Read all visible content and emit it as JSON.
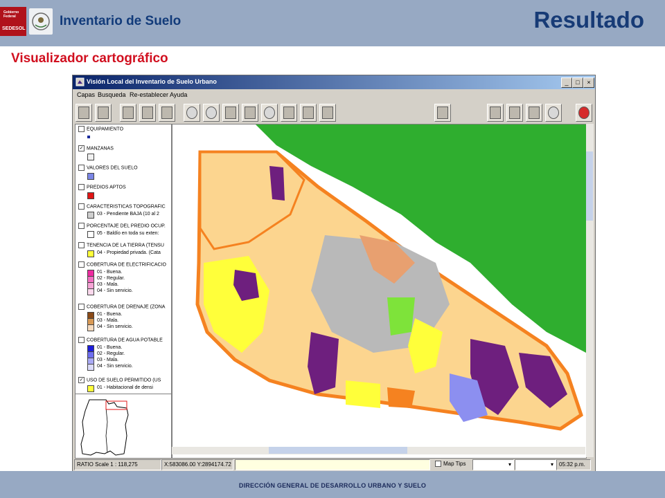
{
  "header": {
    "sedesol_top": "Gobierno Federal",
    "sedesol_name": "SEDESOL",
    "app_title": "Inventario de Suelo",
    "page_heading": "Resultado",
    "subtitle": "Visualizador cartográfico"
  },
  "window": {
    "title": "Visión Local del Inventario de Suelo Urbano",
    "menu": [
      "Capas",
      "Busqueda",
      "Re-establecer",
      "Ayuda"
    ],
    "toolbar_icons": [
      "print-icon",
      "add-layer-icon",
      "list-icon",
      "layer-down-icon",
      "layer-table-icon",
      "zoom-in-icon",
      "zoom-out-icon",
      "back-icon",
      "pan-icon",
      "identify-icon",
      "measure-icon",
      "select-icon",
      "tools-icon",
      "save-icon",
      "report-icon",
      "info-doc-icon",
      "info-layer-icon",
      "help-icon",
      "close-icon"
    ]
  },
  "layers": [
    {
      "label": "EQUIPAMIENTO",
      "checked": false,
      "items": [
        {
          "text": "",
          "color": "#1a2a9c"
        }
      ]
    },
    {
      "label": "MANZANAS",
      "checked": true,
      "items": [
        {
          "text": "",
          "color": "#f0f0f0"
        }
      ]
    },
    {
      "label": "VALORES DEL SUELO",
      "checked": false,
      "items": [
        {
          "text": "",
          "color": "#7b86e6"
        }
      ]
    },
    {
      "label": "PREDIOS APTOS",
      "checked": false,
      "items": [
        {
          "text": "",
          "color": "#e01515"
        }
      ]
    },
    {
      "label": "CARACTERISTICAS TOPOGRAFIC",
      "checked": false,
      "items": [
        {
          "text": "03 - Pendiente BAJA (10 al 2",
          "color": "#cfcfcf"
        }
      ]
    },
    {
      "label": "PORCENTAJE DEL PREDIO OCUP.",
      "checked": false,
      "items": [
        {
          "text": "05 - Baldío en toda su exten:",
          "color": "#ffffff"
        }
      ]
    },
    {
      "label": "TENENCIA DE LA TIERRA (TENSU",
      "checked": false,
      "items": [
        {
          "text": "04 - Propiedad privada. (Cata",
          "color": "#ffff3a"
        }
      ]
    },
    {
      "label": "COBERTURA DE ELECTRIFICACIO",
      "checked": false,
      "items": [
        {
          "text": "01 - Buena.",
          "color": "#ee2aa0"
        },
        {
          "text": "02 - Regular.",
          "color": "#f36fc2"
        },
        {
          "text": "03 - Mala.",
          "color": "#f6a5d6"
        },
        {
          "text": "04 - Sin servicio.",
          "color": "#fbd8ec"
        }
      ]
    },
    {
      "label": "COBERTURA DE DRENAJE (ZONA",
      "checked": false,
      "items": [
        {
          "text": "01 - Buena.",
          "color": "#8a4a17"
        },
        {
          "text": "03 - Mala.",
          "color": "#d99a55"
        },
        {
          "text": "04 - Sin servicio.",
          "color": "#f8dcc0"
        }
      ]
    },
    {
      "label": "COBERTURA DE AGUA POTABLE",
      "checked": false,
      "items": [
        {
          "text": "01 - Buena.",
          "color": "#1d1ddb"
        },
        {
          "text": "02 - Regular.",
          "color": "#6e6ef0"
        },
        {
          "text": "03 - Mala.",
          "color": "#a9a9f5"
        },
        {
          "text": "04 - Sin servicio.",
          "color": "#dcdcfb"
        }
      ]
    },
    {
      "label": "USO DE SUELO PERMITIDO (US",
      "checked": true,
      "items": [
        {
          "text": "01 - Habitacional de densi",
          "color": "#ffff3a"
        }
      ]
    }
  ],
  "status": {
    "scale": "RATIO Scale 1 : 118,275",
    "coords": "X:583086.00 Y:2894174.72",
    "map_tips": "Map Tips",
    "time": "05:32 p.m."
  },
  "footer": "DIRECCIÓN GENERAL DE DESARROLLO URBANO Y SUELO",
  "colors": {
    "banner": "#97a9c3",
    "title_blue": "#173b76",
    "subtitle_red": "#d10f1f",
    "map_green": "#2fae2f",
    "map_orange": "#f58220",
    "map_yellow": "#ffff3a",
    "map_purple": "#6e1f7e",
    "map_tan": "#fcd58f"
  }
}
